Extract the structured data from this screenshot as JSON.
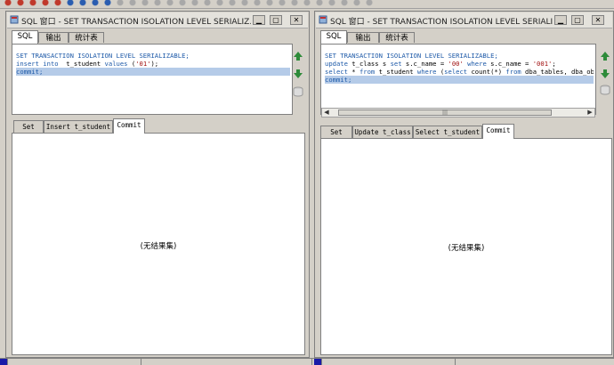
{
  "windows": [
    {
      "title": "SQL 窗口 - SET TRANSACTION ISOLATION LEVEL SERIALIZ...",
      "tabs": [
        {
          "label": "SQL",
          "active": true
        },
        {
          "label": "输出",
          "active": false
        },
        {
          "label": "统计表",
          "active": false
        }
      ],
      "code": [
        {
          "segments": [
            {
              "t": "SET TRANSACTION ISOLATION LEVEL SERIALIZABLE;",
              "c": "kw"
            }
          ],
          "selected": false
        },
        {
          "segments": [
            {
              "t": "insert into ",
              "c": "kw"
            },
            {
              "t": " t_student ",
              "c": ""
            },
            {
              "t": "values",
              "c": "kw"
            },
            {
              "t": " (",
              "c": ""
            },
            {
              "t": "'01'",
              "c": "str"
            },
            {
              "t": ");",
              "c": ""
            }
          ],
          "selected": false
        },
        {
          "segments": [
            {
              "t": "commit;",
              "c": "kw"
            }
          ],
          "selected": true
        }
      ],
      "result_tabs": [
        {
          "label": "Set",
          "active": false
        },
        {
          "label": "Insert t_student",
          "active": false
        },
        {
          "label": "Commit",
          "active": true
        }
      ],
      "result_text": "(无结果集)"
    },
    {
      "title": "SQL 窗口 - SET TRANSACTION ISOLATION LEVEL SERIALI...",
      "tabs": [
        {
          "label": "SQL",
          "active": true
        },
        {
          "label": "输出",
          "active": false
        },
        {
          "label": "统计表",
          "active": false
        }
      ],
      "code": [
        {
          "segments": [
            {
              "t": "SET TRANSACTION ISOLATION LEVEL SERIALIZABLE;",
              "c": "kw"
            }
          ],
          "selected": false
        },
        {
          "segments": [
            {
              "t": "update",
              "c": "kw"
            },
            {
              "t": " t_class s ",
              "c": ""
            },
            {
              "t": "set",
              "c": "kw"
            },
            {
              "t": " s.c_name = ",
              "c": ""
            },
            {
              "t": "'00'",
              "c": "str"
            },
            {
              "t": " where ",
              "c": "kw"
            },
            {
              "t": "s.c_name = ",
              "c": ""
            },
            {
              "t": "'001'",
              "c": "str"
            },
            {
              "t": ";",
              "c": ""
            }
          ],
          "selected": false
        },
        {
          "segments": [
            {
              "t": "select",
              "c": "kw"
            },
            {
              "t": " * ",
              "c": ""
            },
            {
              "t": "from",
              "c": "kw"
            },
            {
              "t": " t_student ",
              "c": ""
            },
            {
              "t": "where",
              "c": "kw"
            },
            {
              "t": " (",
              "c": ""
            },
            {
              "t": "select",
              "c": "kw"
            },
            {
              "t": " count(*) ",
              "c": ""
            },
            {
              "t": "from",
              "c": "kw"
            },
            {
              "t": " dba_tables, dba_obj…",
              "c": ""
            }
          ],
          "selected": false
        },
        {
          "segments": [
            {
              "t": "commit;",
              "c": "kw"
            }
          ],
          "selected": true
        }
      ],
      "result_tabs": [
        {
          "label": "Set",
          "active": false
        },
        {
          "label": "Update t_class",
          "active": false
        },
        {
          "label": "Select t_student",
          "active": false
        },
        {
          "label": "Commit",
          "active": true
        }
      ],
      "result_text": "(无结果集)"
    }
  ],
  "colors": {
    "keyword": "#1e5aa8",
    "string": "#a01010",
    "selection": "#b5cbe8",
    "arrow": "#2e8b3a"
  },
  "icons": {
    "window_icon": "sql-window-icon",
    "minimize": "minimize-icon",
    "maximize": "maximize-icon",
    "close": "close-icon",
    "prev": "arrow-up-icon",
    "next": "arrow-down-icon",
    "db": "database-icon"
  }
}
